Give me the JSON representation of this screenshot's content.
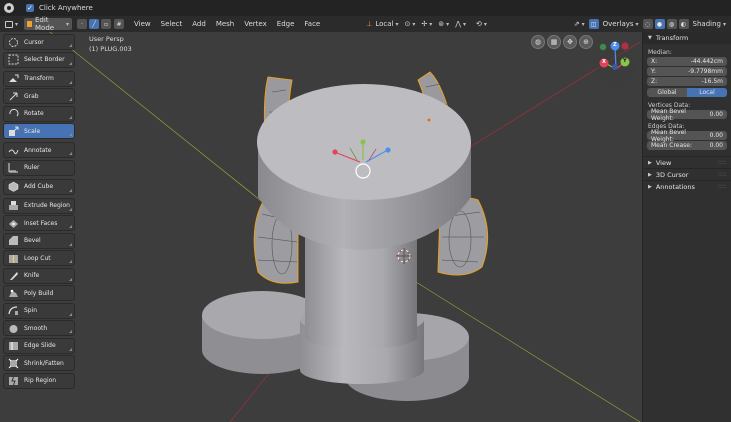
{
  "status_bar": {
    "click_anywhere_label": "Click Anywhere"
  },
  "header": {
    "mode_label": "Edit Mode",
    "menus": [
      "View",
      "Select",
      "Add",
      "Mesh",
      "Vertex",
      "Edge",
      "Face"
    ],
    "orientation_label": "Local",
    "overlays_label": "Overlays",
    "shading_label": "Shading"
  },
  "viewport": {
    "view_name": "User Persp",
    "object_name": "(1) PLUG.003"
  },
  "toolbar": {
    "tools": [
      {
        "label": "Cursor",
        "icon": "cursor-icon",
        "active": false
      },
      {
        "label": "Select Border",
        "icon": "select-border-icon",
        "active": false
      },
      {
        "label": "Transform",
        "icon": "transform-icon",
        "active": false
      },
      {
        "label": "Grab",
        "icon": "grab-icon",
        "active": false
      },
      {
        "label": "Rotate",
        "icon": "rotate-icon",
        "active": false
      },
      {
        "label": "Scale",
        "icon": "scale-icon",
        "active": true
      },
      {
        "label": "Annotate",
        "icon": "annotate-icon",
        "active": false
      },
      {
        "label": "Ruler",
        "icon": "ruler-icon",
        "active": false
      },
      {
        "label": "Add Cube",
        "icon": "add-cube-icon",
        "active": false
      },
      {
        "label": "Extrude Region",
        "icon": "extrude-region-icon",
        "active": false
      },
      {
        "label": "Inset Faces",
        "icon": "inset-faces-icon",
        "active": false
      },
      {
        "label": "Bevel",
        "icon": "bevel-icon",
        "active": false
      },
      {
        "label": "Loop Cut",
        "icon": "loop-cut-icon",
        "active": false
      },
      {
        "label": "Knife",
        "icon": "knife-icon",
        "active": false
      },
      {
        "label": "Poly Build",
        "icon": "poly-build-icon",
        "active": false
      },
      {
        "label": "Spin",
        "icon": "spin-icon",
        "active": false
      },
      {
        "label": "Smooth",
        "icon": "smooth-icon",
        "active": false
      },
      {
        "label": "Edge Slide",
        "icon": "edge-slide-icon",
        "active": false
      },
      {
        "label": "Shrink/Fatten",
        "icon": "shrink-fatten-icon",
        "active": false
      },
      {
        "label": "Rip Region",
        "icon": "rip-region-icon",
        "active": false
      }
    ]
  },
  "gizmo": {
    "z_label": "Z",
    "x_label": "X",
    "y_label": "Y"
  },
  "sidebar": {
    "transform_title": "Transform",
    "median_label": "Median:",
    "x_label": "X:",
    "x_value": "-44.442cm",
    "y_label": "Y:",
    "y_value": "-9.7798mm",
    "z_label": "Z:",
    "z_value": "-16.5m",
    "global_label": "Global",
    "local_label": "Local",
    "vertices_data_label": "Vertices Data:",
    "mean_bevel_weight_label": "Mean Bevel Weight:",
    "vertices_bevel_weight_value": "0.00",
    "edges_data_label": "Edges Data:",
    "edges_bevel_weight_value": "0.00",
    "mean_crease_label": "Mean Crease:",
    "mean_crease_value": "0.00",
    "view_title": "View",
    "cursor_title": "3D Cursor",
    "annotations_title": "Annotations"
  },
  "colors": {
    "accent": "#4772b3",
    "axis_x": "#e2435b",
    "axis_y": "#8bc34a",
    "axis_z": "#4d8df0",
    "selection": "#e8a020"
  }
}
